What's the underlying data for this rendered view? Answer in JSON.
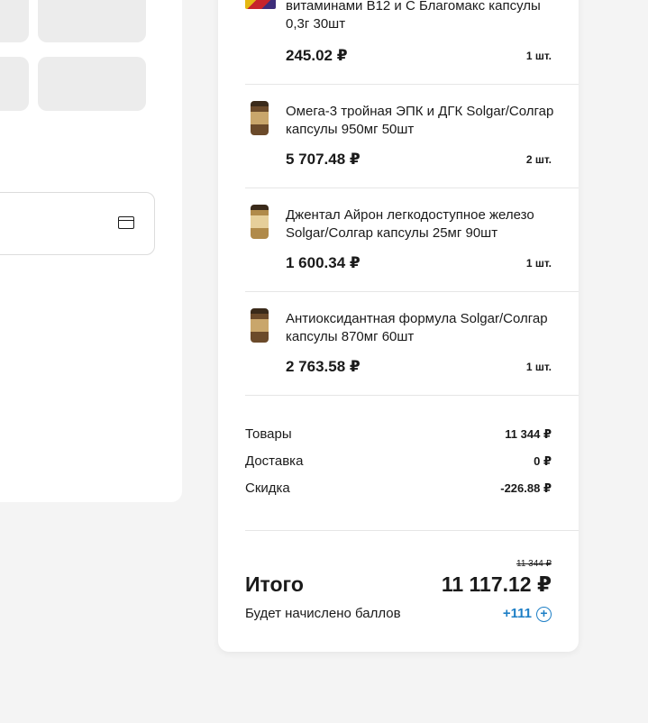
{
  "order": {
    "items": [
      {
        "name": "витаминами B12 и С Благомакс капсулы 0,3г 30шт",
        "price": "245.02 ₽",
        "qty": "1 шт."
      },
      {
        "name": "Омега-3 тройная ЭПК и ДГК Solgar/Солгар капсулы 950мг 50шт",
        "price": "5 707.48 ₽",
        "qty": "2 шт."
      },
      {
        "name": "Джентал Айрон легкодоступное железо Solgar/Солгар капсулы 25мг 90шт",
        "price": "1 600.34 ₽",
        "qty": "1 шт."
      },
      {
        "name": "Антиоксидантная формула Solgar/Солгар капсулы 870мг 60шт",
        "price": "2 763.58 ₽",
        "qty": "1 шт."
      }
    ],
    "summary": {
      "goods_label": "Товары",
      "goods_value": "11 344 ₽",
      "delivery_label": "Доставка",
      "delivery_value": "0 ₽",
      "discount_label": "Скидка",
      "discount_value": "-226.88 ₽"
    },
    "total": {
      "old_value": "11 344 ₽",
      "label": "Итого",
      "value": "11 117.12 ₽"
    },
    "bonus": {
      "label": "Будет начислено баллов",
      "value": "+111",
      "icon": "plus-circle-icon"
    }
  },
  "colors": {
    "accent": "#1e7fc6",
    "background": "#f4f4f4"
  }
}
